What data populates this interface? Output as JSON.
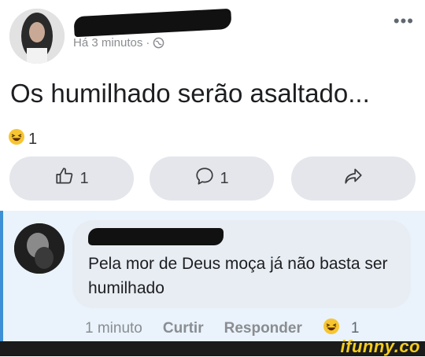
{
  "post": {
    "time_label": "Há 3 minutos",
    "separator": "·",
    "text": "Os humilhado serão asaltado...",
    "more_label": "•••",
    "reaction_count": "1"
  },
  "actions": {
    "like_count": "1",
    "comment_count": "1"
  },
  "comment": {
    "text": "Pela mor de Deus moça já não basta ser humilhado",
    "time": "1 minuto",
    "like_label": "Curtir",
    "reply_label": "Responder",
    "reaction_count": "1"
  },
  "watermark": "ifunny.co",
  "colors": {
    "accent_border": "#3d8fd6",
    "comment_bg": "#eaf3fb",
    "button_bg": "#e4e6eb",
    "watermark": "#f6cd1a"
  }
}
